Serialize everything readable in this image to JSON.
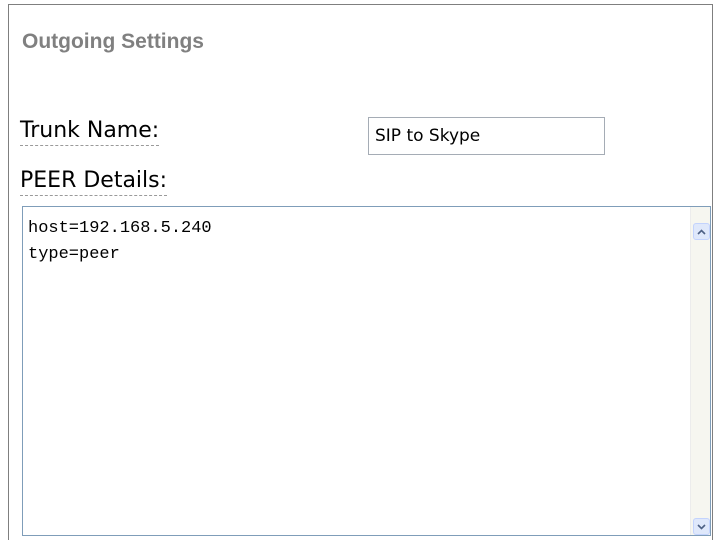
{
  "section": {
    "title": "Outgoing Settings"
  },
  "trunk": {
    "label": "Trunk Name:",
    "value": "SIP to Skype"
  },
  "peer": {
    "label": "PEER Details:",
    "value": "host=192.168.5.240\ntype=peer"
  },
  "icons": {
    "scroll_up": "chevron-up-icon",
    "scroll_down": "chevron-down-icon"
  },
  "colors": {
    "title": "#808080",
    "textarea_border": "#7f9db9",
    "scroll_button": "#dfe8fb"
  }
}
